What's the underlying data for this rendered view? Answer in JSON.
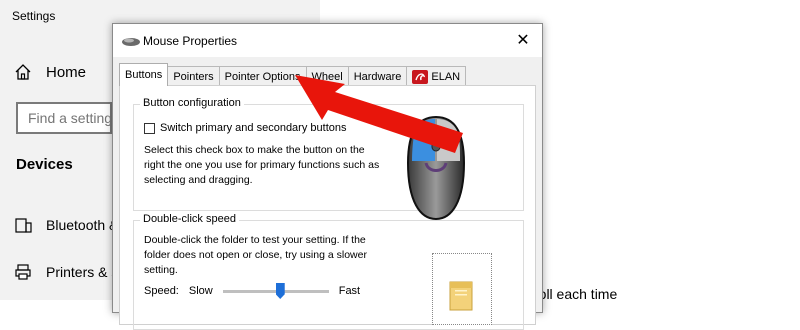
{
  "settings": {
    "title": "Settings",
    "home_label": "Home",
    "search_placeholder": "Find a setting",
    "section_title": "Devices",
    "nav_items": [
      {
        "label": "Bluetooth & other devices"
      },
      {
        "label": "Printers & scanners"
      }
    ],
    "background_text": "roll each time"
  },
  "dialog": {
    "title": "Mouse Properties",
    "tabs": [
      {
        "label": "Buttons"
      },
      {
        "label": "Pointers"
      },
      {
        "label": "Pointer Options"
      },
      {
        "label": "Wheel"
      },
      {
        "label": "Hardware"
      },
      {
        "label": "ELAN"
      }
    ],
    "button_config": {
      "group_label": "Button configuration",
      "checkbox_label": "Switch primary and secondary buttons",
      "description": "Select this check box to make the button on the right the one you use for primary functions such as selecting and dragging."
    },
    "double_click": {
      "group_label": "Double-click speed",
      "description": "Double-click the folder to test your setting. If the folder does not open or close, try using a slower setting.",
      "speed_label": "Speed:",
      "slow_label": "Slow",
      "fast_label": "Fast",
      "speed_value": 0.55
    }
  },
  "colors": {
    "arrow": "#e8150b",
    "accent": "#1e6fd8"
  }
}
